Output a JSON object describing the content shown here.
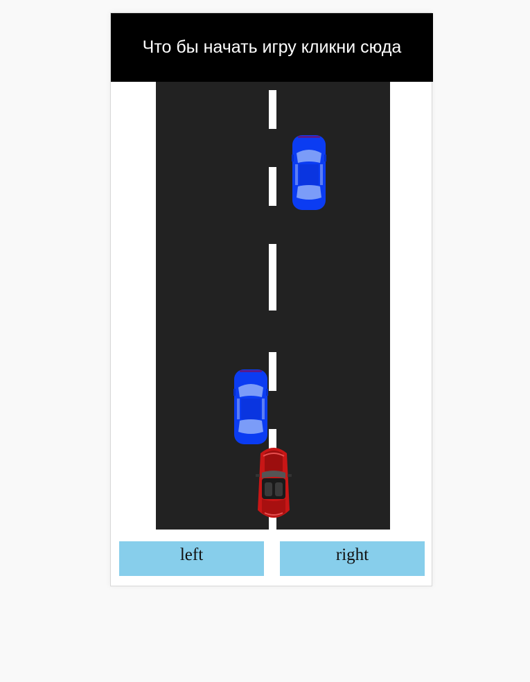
{
  "banner": {
    "text": "Что бы начать игру кликни сюда"
  },
  "controls": {
    "left_label": "left",
    "right_label": "right"
  },
  "colors": {
    "banner_bg": "#000000",
    "road": "#222222",
    "lane_marking": "#ffffff",
    "button_bg": "#87ceeb",
    "player_car": "#c81616",
    "enemy_car": "#0b3cf2"
  },
  "game": {
    "player_car": {
      "color": "red",
      "lane": "center"
    },
    "enemy_cars": [
      {
        "color": "blue",
        "lane": "right"
      },
      {
        "color": "blue",
        "lane": "left"
      }
    ]
  }
}
